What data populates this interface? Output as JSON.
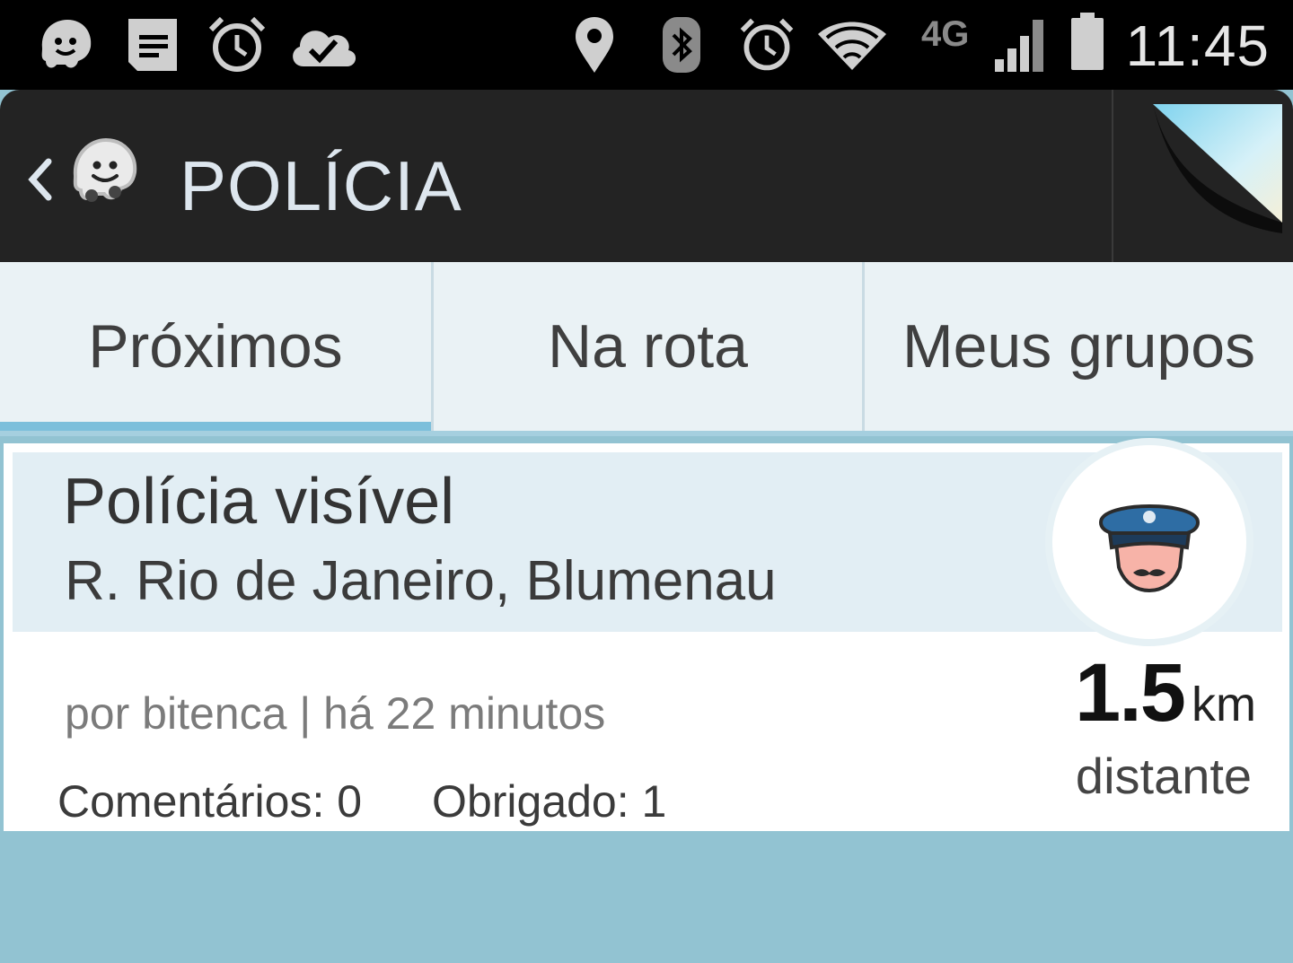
{
  "status_bar": {
    "time": "11:45",
    "network": "4G",
    "icons": [
      "waze-notification-icon",
      "notes-icon",
      "alarm-icon",
      "cloud-done-icon",
      "location-pin-icon",
      "bluetooth-icon",
      "alarm-icon",
      "wifi-icon",
      "signal-icon",
      "battery-icon"
    ]
  },
  "action_bar": {
    "title": "POLÍCIA",
    "back_icon": "chevron-left-icon",
    "app_icon": "waze-logo-icon",
    "menu_icon": "page-curl-icon"
  },
  "tabs": [
    {
      "label": "Próximos",
      "active": true
    },
    {
      "label": "Na rota",
      "active": false
    },
    {
      "label": "Meus grupos",
      "active": false
    }
  ],
  "alert": {
    "title": "Polícia visível",
    "address": "R. Rio de Janeiro, Blumenau",
    "reporter": "por bitenca | há 22 minutos",
    "comments": "Comentários: 0",
    "thanks": "Obrigado: 1",
    "distance_value": "1.5",
    "distance_unit": "km",
    "distance_label": "distante",
    "icon": "police-officer-icon"
  },
  "colors": {
    "status_bar": "#000000",
    "action_bar": "#232323",
    "tab_indicator": "#7cbfdb",
    "background": "#92c3d2"
  }
}
